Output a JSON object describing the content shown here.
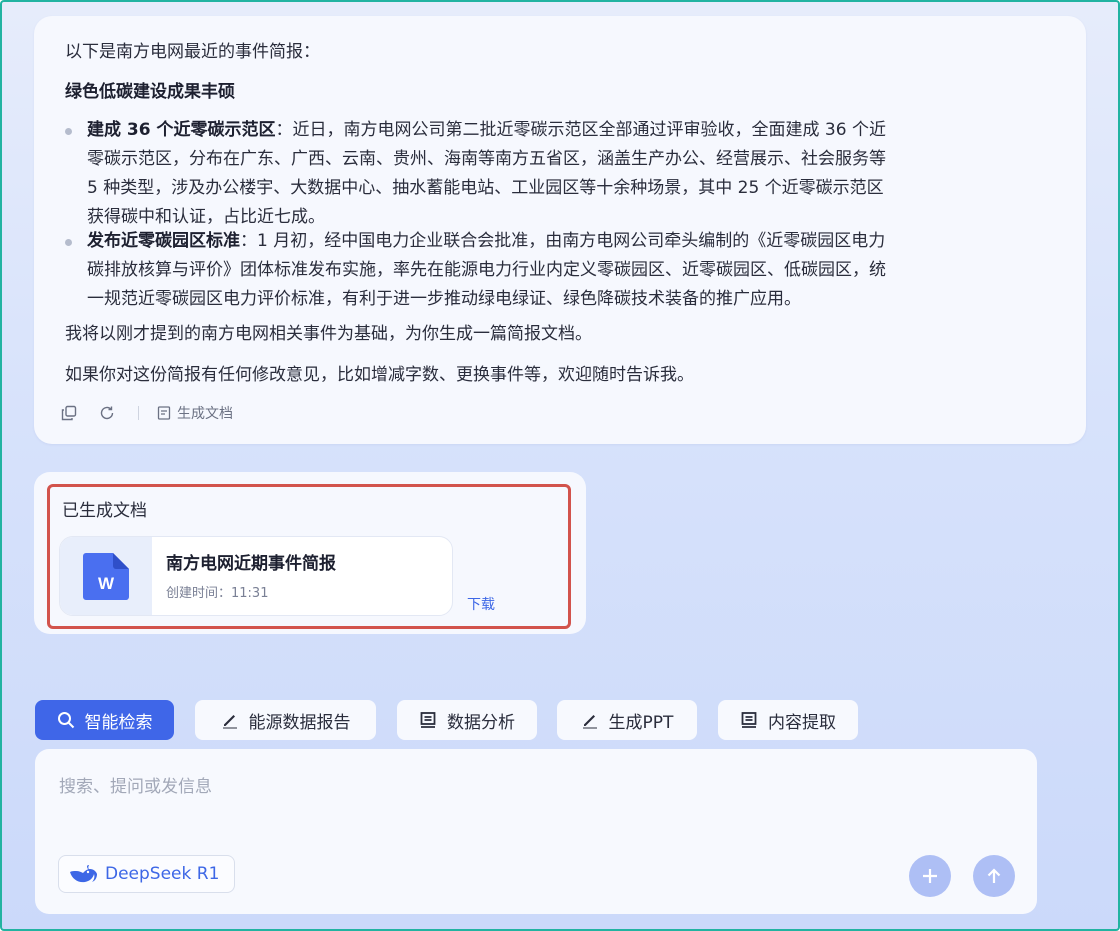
{
  "message": {
    "intro": "以下是南方电网最近的事件简报：",
    "heading": "绿色低碳建设成果丰硕",
    "bullets": [
      {
        "title": "建成 36 个近零碳示范区",
        "line1": "：近日，南方电网公司第二批近零碳示范区全部通过评审验收，全面建成 36 个近",
        "line2": "零碳示范区，分布在广东、广西、云南、贵州、海南等南方五省区，涵盖生产办公、经营展示、社会服务等",
        "line3": "5 种类型，涉及办公楼宇、大数据中心、抽水蓄能电站、工业园区等十余种场景，其中 25 个近零碳示范区",
        "line4": "获得碳中和认证，占比近七成。"
      },
      {
        "title": "发布近零碳园区标准",
        "line1": "：1 月初，经中国电力企业联合会批准，由南方电网公司牵头编制的《近零碳园区电力",
        "line2": "碳排放核算与评价》团体标准发布实施，率先在能源电力行业内定义零碳园区、近零碳园区、低碳园区，统",
        "line3": "一规范近零碳园区电力评价标准，有利于进一步推动绿电绿证、绿色降碳技术装备的推广应用。"
      }
    ],
    "para1": "我将以刚才提到的南方电网相关事件为基础，为你生成一篇简报文档。",
    "para2": "如果你对这份简报有任何修改意见，比如增减字数、更换事件等，欢迎随时告诉我。",
    "actions": {
      "copy_icon": "copy-icon",
      "refresh_icon": "refresh-icon",
      "generate_doc_label": "生成文档"
    }
  },
  "generated": {
    "title": "已生成文档",
    "doc_name": "南方电网近期事件简报",
    "doc_time": "创建时间：11:31",
    "doc_icon_letter": "W",
    "download_label": "下载"
  },
  "chips": [
    {
      "label": "智能检索",
      "icon": "search-icon",
      "active": true
    },
    {
      "label": "能源数据报告",
      "icon": "pen-icon",
      "active": false
    },
    {
      "label": "数据分析",
      "icon": "document-icon",
      "active": false
    },
    {
      "label": "生成PPT",
      "icon": "pen-icon",
      "active": false
    },
    {
      "label": "内容提取",
      "icon": "document-icon",
      "active": false
    }
  ],
  "input": {
    "placeholder": "搜索、提问或发信息",
    "value": "",
    "model_label": "DeepSeek R1"
  },
  "colors": {
    "accent": "#3f66e8",
    "highlight_border": "#d2534c",
    "frame_border": "#22b3a1"
  }
}
